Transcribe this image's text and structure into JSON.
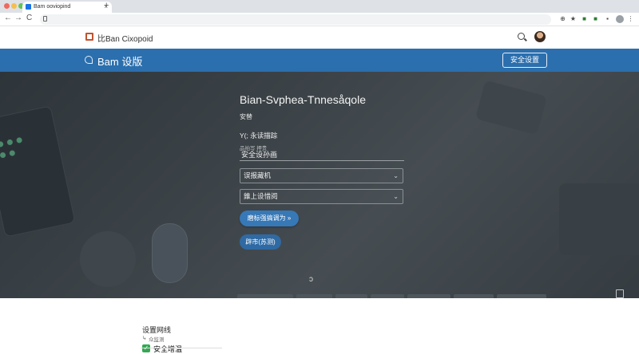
{
  "browser": {
    "tab_title": "Bam ooviopind",
    "tab_close": "×",
    "new_tab": "+",
    "nav": {
      "back": "←",
      "forward": "→",
      "reload": "C"
    }
  },
  "site_header": {
    "logo_text": "比Ban Cixopoid"
  },
  "band": {
    "title": "Bam 设版",
    "action_button": "安全设置"
  },
  "form": {
    "title": "Bian-Svphea-Tnnesåqole",
    "subtitle": "安替",
    "field_label": "Y(; 永读描踪",
    "field_hint": "品拍写 押贵",
    "field_value": "安全设孙画",
    "select_1": "误报藏机",
    "select_2": "錐上设惜阅",
    "primary_button": "磨标强搞调为 »",
    "secondary_button": "辟市(苏测)",
    "scroll_indicator": "ɔ"
  },
  "section": {
    "title": "设置网线",
    "subtitle": "众监测",
    "subtitle_icon": "↳",
    "check_label": "安全增温"
  },
  "colors": {
    "brand_blue": "#2b6fae",
    "button_blue": "#3778b7",
    "hero_bg": "#3b4247"
  },
  "icons": {
    "search": "search-icon",
    "check": "check-icon"
  }
}
